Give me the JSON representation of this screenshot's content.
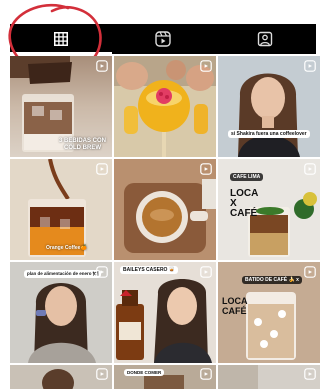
{
  "tabs": [
    {
      "name": "grid-tab",
      "icon": "grid-icon",
      "active": true
    },
    {
      "name": "reels-tab",
      "icon": "reels-icon",
      "active": false
    },
    {
      "name": "tagged-tab",
      "icon": "tagged-icon",
      "active": false
    }
  ],
  "posts": [
    {
      "caption": "3 BEBIDAS CON\nCOLD BREW",
      "type": "reel"
    },
    {
      "caption": "",
      "type": "reel"
    },
    {
      "caption": "si Shakira fuera una coffeelover",
      "type": "reel"
    },
    {
      "caption": "Orange Coffee🍊",
      "type": "reel"
    },
    {
      "caption": "",
      "type": "reel"
    },
    {
      "caption": "CAFE LIMA",
      "overlay_text": "LOCA\nX\nCAFÉ",
      "type": "reel"
    },
    {
      "caption": "plan de alimentación de enero 🍽",
      "type": "reel"
    },
    {
      "caption": "BAILEYS CASERO 🥃",
      "type": "reel"
    },
    {
      "caption": "BATIDO DE CAFÉ 🍌 x",
      "overlay_text": "LOCA\nCAFÉ",
      "type": "reel"
    },
    {
      "caption": "",
      "type": "reel"
    },
    {
      "caption": "DONDE COMER",
      "type": "reel"
    },
    {
      "caption": "",
      "type": "reel"
    }
  ],
  "colors": {
    "tabbar_bg": "#000000",
    "annotation": "#d32f3a"
  }
}
